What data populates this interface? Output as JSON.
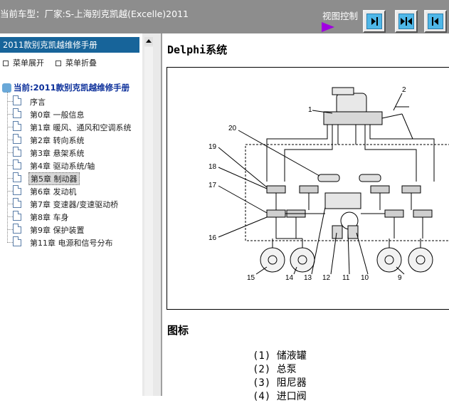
{
  "header": {
    "title": "当前车型：厂家:S-上海别克凯越(Excelle)2011",
    "view_control_label": "视图控制",
    "view_buttons": [
      {
        "name": "collapse-left",
        "icon": "arrow-into-right-bar-icon"
      },
      {
        "name": "split-view",
        "icon": "split-view-icon"
      },
      {
        "name": "expand-right",
        "icon": "arrow-from-left-bar-icon"
      }
    ],
    "accent_color": "#a000e0"
  },
  "sidebar": {
    "manual_title": "2011款别克凯越维修手册",
    "expand_label": "菜单展开",
    "collapse_label": "菜单折叠",
    "root_label": "当前:2011款别克凯越维修手册",
    "items": [
      {
        "label": "序言"
      },
      {
        "label": "第0章 一般信息"
      },
      {
        "label": "第1章 暖风、通风和空调系统"
      },
      {
        "label": "第2章 转向系统"
      },
      {
        "label": "第3章 悬架系统"
      },
      {
        "label": "第4章 驱动系统/轴"
      },
      {
        "label": "第5章 制动器",
        "selected": true
      },
      {
        "label": "第6章 发动机"
      },
      {
        "label": "第7章 变速器/变速驱动桥"
      },
      {
        "label": "第8章 车身"
      },
      {
        "label": "第9章 保护装置"
      },
      {
        "label": "第11章 电源和信号分布"
      }
    ],
    "selected_color": "#d8d8d8",
    "header_color": "#17649a"
  },
  "content": {
    "heading": "Delphi系统",
    "legend_title": "图标",
    "legend": [
      {
        "num": "(1)",
        "label": "储液罐"
      },
      {
        "num": "(2)",
        "label": "总泵"
      },
      {
        "num": "(3)",
        "label": "阻尼器"
      },
      {
        "num": "(4)",
        "label": "进口阀"
      }
    ],
    "diagram_labels": [
      "1",
      "2",
      "20",
      "19",
      "18",
      "17",
      "16",
      "15",
      "14",
      "13",
      "12",
      "11",
      "10",
      "9"
    ]
  }
}
